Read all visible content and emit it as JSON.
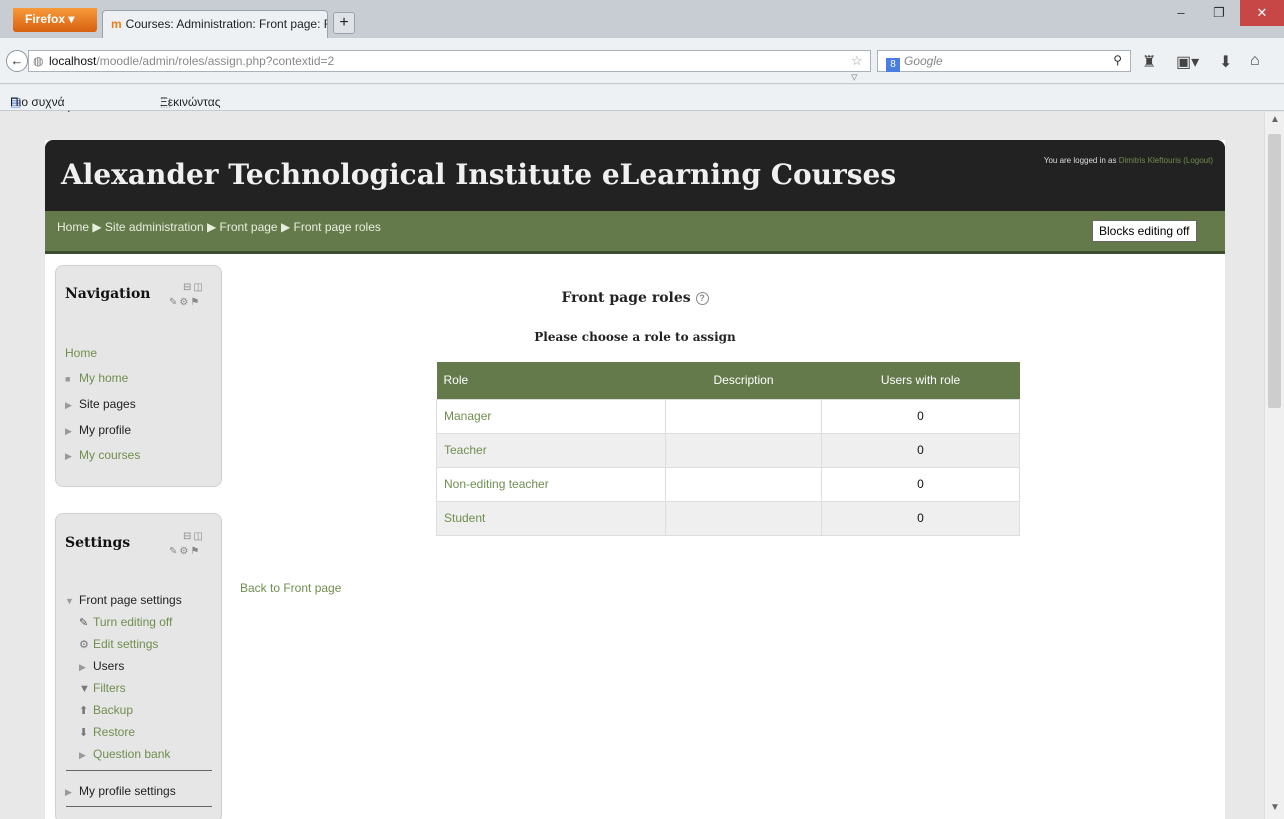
{
  "browser": {
    "menu_label": "Firefox ▾",
    "tab_title": "Courses: Administration: Front page: Fro...",
    "url_host": "localhost",
    "url_path": "/moodle/admin/roles/assign.php?contextid=2",
    "search_placeholder": "Google",
    "bookmarks": [
      "Πιο συχνά αναγνωσμέ...",
      "Ξεκινώντας"
    ]
  },
  "header": {
    "site_title": "Alexander Technological Institute eLearning Courses",
    "login_prefix": "You are logged in as",
    "login_user": "Dimitris Kleftouris",
    "logout_label": "(Logout)"
  },
  "breadcrumb": [
    "Home",
    "Site administration",
    "Front page",
    "Front page roles"
  ],
  "blocks_editing_button": "Blocks editing off",
  "navigation_block": {
    "title": "Navigation",
    "home": "Home",
    "items": [
      "My home",
      "Site pages",
      "My profile",
      "My courses"
    ]
  },
  "settings_block": {
    "title": "Settings",
    "section": "Front page settings",
    "items": [
      "Turn editing off",
      "Edit settings",
      "Users",
      "Filters",
      "Backup",
      "Restore",
      "Question bank"
    ],
    "profile": "My profile settings"
  },
  "main": {
    "heading": "Front page roles",
    "subheading": "Please choose a role to assign",
    "columns": [
      "Role",
      "Description",
      "Users with role"
    ],
    "rows": [
      {
        "role": "Manager",
        "description": "",
        "count": "0"
      },
      {
        "role": "Teacher",
        "description": "",
        "count": "0"
      },
      {
        "role": "Non-editing teacher",
        "description": "",
        "count": "0"
      },
      {
        "role": "Student",
        "description": "",
        "count": "0"
      }
    ],
    "back_link": "Back to Front page"
  },
  "colors": {
    "accent_green": "#647a4b",
    "link_green": "#6f8e4f",
    "header_dark": "#222222"
  }
}
